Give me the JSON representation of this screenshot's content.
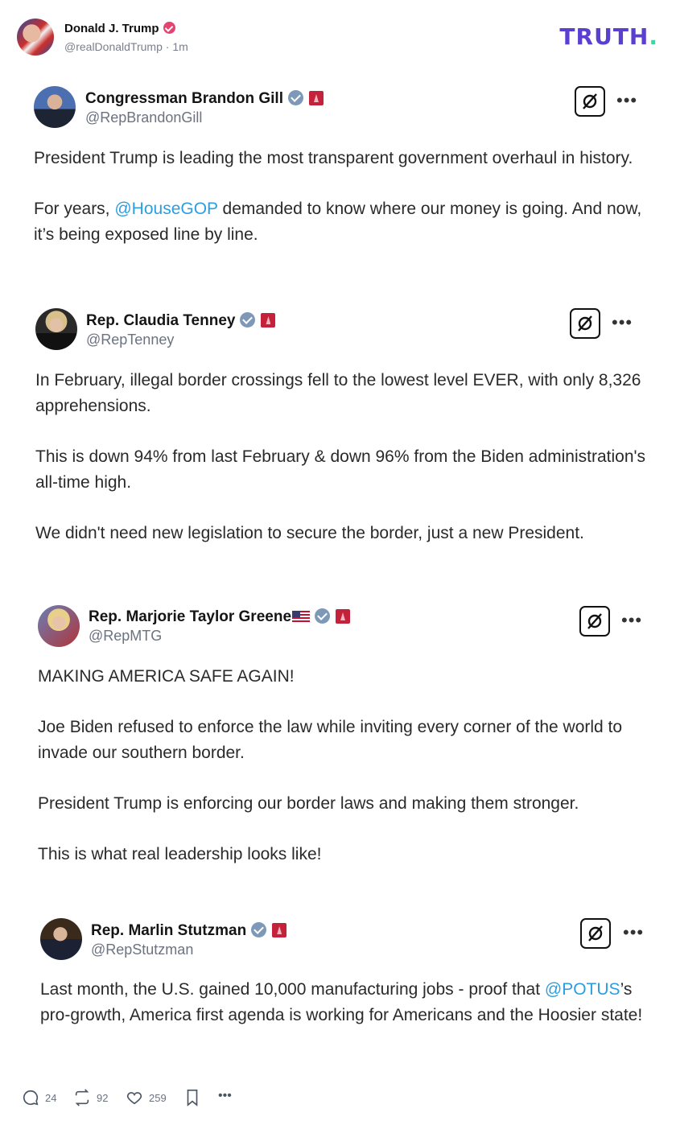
{
  "header": {
    "name": "Donald J. Trump",
    "handle": "@realDonaldTrump",
    "time": "1m",
    "logo": "TRUTH",
    "logo_dot": "."
  },
  "posts": [
    {
      "name": "Congressman Brandon Gill",
      "handle": "@RepBrandonGill",
      "paragraphs": [
        "President Trump is leading the most transparent government overhaul in history.",
        "For years, @HouseGOP demanded to know where our money is going. And now, it’s being exposed line by line."
      ],
      "p2_pre": "For years, ",
      "p2_mention": "@HouseGOP",
      "p2_post": " demanded to know where our money is going. And now, it’s being exposed line by line."
    },
    {
      "name": "Rep. Claudia Tenney",
      "handle": "@RepTenney",
      "paragraphs": [
        "In February, illegal border crossings fell to the lowest level EVER, with only 8,326 apprehensions.",
        "This is down 94% from last February & down 96% from the Biden administration's all-time high.",
        "We didn't need new legislation to secure the border, just a new President."
      ]
    },
    {
      "name": "Rep. Marjorie Taylor Greene",
      "handle": "@RepMTG",
      "paragraphs": [
        "MAKING AMERICA SAFE AGAIN!",
        "Joe Biden refused to enforce the law while inviting every corner of the world to invade our southern border.",
        "President Trump is enforcing our border laws and making them stronger.",
        "This is what real leadership looks like!"
      ]
    },
    {
      "name": "Rep. Marlin Stutzman",
      "handle": "@RepStutzman",
      "p1_pre": "Last month, the U.S. gained 10,000 manufacturing jobs - proof that ",
      "p1_mention": "@POTUS",
      "p1_post": "’s pro-growth, America first agenda is working for Americans and the Hoosier state!"
    }
  ],
  "footer": {
    "replies": "24",
    "retruths": "92",
    "likes": "259"
  },
  "icons": [
    "x-logo-icon",
    "more-icon",
    "reply-icon",
    "retruth-icon",
    "like-icon",
    "bookmark-icon"
  ],
  "colors": {
    "mention": "#2c9ee0",
    "brand": "#5a3fd1",
    "brand_dot": "#37d9a4",
    "verified": "#e5436f"
  }
}
